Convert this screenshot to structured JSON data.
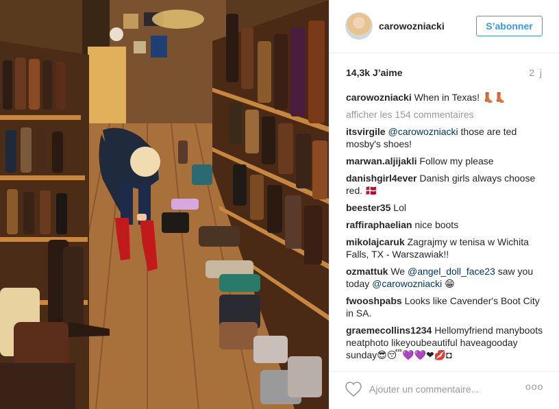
{
  "post": {
    "photo_icon": "boot-store-photo",
    "header": {
      "username": "carowozniacki",
      "follow_label": "S’abonner"
    },
    "stats": {
      "likes": "14,3k J’aime",
      "time": "2 j"
    },
    "caption": {
      "user": "carowozniacki",
      "text": "When in Texas! 👢👢"
    },
    "view_all_comments": "afficher les 154 commentaires",
    "comments": [
      {
        "user": "itsvirgile",
        "parts": [
          {
            "mention": "@carowozniacki"
          },
          {
            "text": " those are ted mosby's shoes!"
          }
        ]
      },
      {
        "user": "marwan.aljijakli",
        "parts": [
          {
            "text": "Follow my please"
          }
        ]
      },
      {
        "user": "danishgirl4ever",
        "parts": [
          {
            "text": "Danish girls always choose red. 🇩🇰"
          }
        ]
      },
      {
        "user": "beester35",
        "parts": [
          {
            "text": "Lol"
          }
        ]
      },
      {
        "user": "raffiraphaelian",
        "parts": [
          {
            "text": "nice boots"
          }
        ]
      },
      {
        "user": "mikolajcaruk",
        "parts": [
          {
            "text": "Zagrajmy w tenisa w Wichita Falls, TX - Warszawiak!!"
          }
        ]
      },
      {
        "user": "ozmattuk",
        "parts": [
          {
            "text": "We "
          },
          {
            "mention": "@angel_doll_face23"
          },
          {
            "text": " saw you today "
          },
          {
            "mention": "@carowozniacki"
          },
          {
            "text": " 😁"
          }
        ]
      },
      {
        "user": "fwooshpabs",
        "parts": [
          {
            "text": "Looks like Cavender's Boot City in SA."
          }
        ]
      },
      {
        "user": "graemecollins1234",
        "parts": [
          {
            "text": "Hellomyfriend manyboots neatphoto likeyoubeautiful haveagooday sunday😎😴💜💜❤💋◘"
          }
        ]
      }
    ],
    "footer": {
      "heart_icon": "heart-icon",
      "comment_placeholder": "Ajouter un commentaire...",
      "more_label": "ooo"
    }
  }
}
